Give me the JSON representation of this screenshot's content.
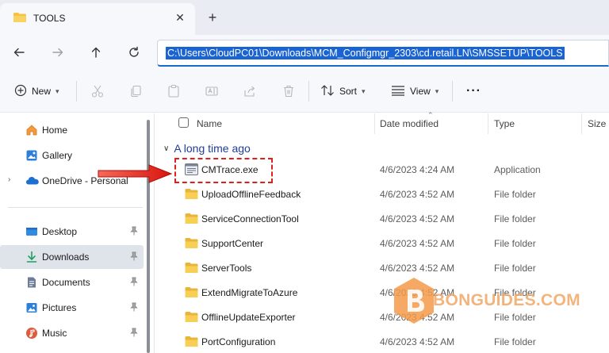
{
  "window": {
    "tab_title": "TOOLS",
    "close_symbol": "✕",
    "new_tab_symbol": "+"
  },
  "navigation": {
    "address": "C:\\Users\\CloudPC01\\Downloads\\MCM_Configmgr_2303\\cd.retail.LN\\SMSSETUP\\TOOLS",
    "icons": [
      "back-arrow-icon",
      "forward-arrow-icon",
      "up-arrow-icon",
      "refresh-icon"
    ]
  },
  "toolbar": {
    "new_label": "New",
    "sort_label": "Sort",
    "view_label": "View",
    "more_label": "···",
    "icons": [
      "cut-icon",
      "copy-icon",
      "paste-icon",
      "rename-icon",
      "share-icon",
      "delete-icon"
    ]
  },
  "sidebar": {
    "items": [
      {
        "label": "Home",
        "icon": "home-icon"
      },
      {
        "label": "Gallery",
        "icon": "gallery-icon"
      },
      {
        "label": "OneDrive - Personal",
        "icon": "cloud-icon"
      },
      {
        "label": "Desktop",
        "icon": "desktop-icon"
      },
      {
        "label": "Downloads",
        "icon": "download-icon"
      },
      {
        "label": "Documents",
        "icon": "documents-icon"
      },
      {
        "label": "Pictures",
        "icon": "pictures-icon"
      },
      {
        "label": "Music",
        "icon": "music-icon"
      }
    ],
    "expand_symbol": "›"
  },
  "columns": {
    "name": "Name",
    "date": "Date modified",
    "type": "Type",
    "size": "Size"
  },
  "group": {
    "title": "A long time ago",
    "chevron": "∨"
  },
  "files": [
    {
      "name": "CMTrace.exe",
      "date": "4/6/2023 4:24 AM",
      "type": "Application",
      "icon": "application-icon"
    },
    {
      "name": "UploadOfflineFeedback",
      "date": "4/6/2023 4:52 AM",
      "type": "File folder",
      "icon": "folder-icon"
    },
    {
      "name": "ServiceConnectionTool",
      "date": "4/6/2023 4:52 AM",
      "type": "File folder",
      "icon": "folder-icon"
    },
    {
      "name": "SupportCenter",
      "date": "4/6/2023 4:52 AM",
      "type": "File folder",
      "icon": "folder-icon"
    },
    {
      "name": "ServerTools",
      "date": "4/6/2023 4:52 AM",
      "type": "File folder",
      "icon": "folder-icon"
    },
    {
      "name": "ExtendMigrateToAzure",
      "date": "4/6/2023 4:52 AM",
      "type": "File folder",
      "icon": "folder-icon"
    },
    {
      "name": "OfflineUpdateExporter",
      "date": "4/6/2023 4:52 AM",
      "type": "File folder",
      "icon": "folder-icon"
    },
    {
      "name": "PortConfiguration",
      "date": "4/6/2023 4:52 AM",
      "type": "File folder",
      "icon": "folder-icon"
    }
  ],
  "watermark": {
    "text": "BONGUIDES.COM",
    "color": "#f39a4a"
  },
  "colors": {
    "accent": "#1a63d2",
    "highlight": "#e0201b",
    "folder": "#f5c242"
  }
}
